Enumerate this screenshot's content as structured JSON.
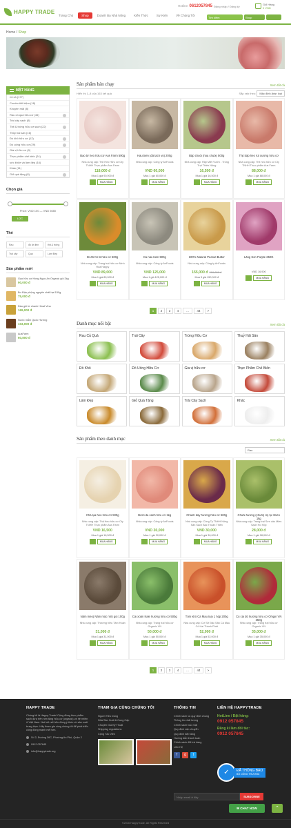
{
  "header": {
    "logo": "HAPPY TRADE",
    "nav": [
      "Trang Chủ",
      "Shop",
      "Doanh Ba Nhà Nông",
      "Kiến Thức",
      "Sự Kiện",
      "Về Chúng Tôi"
    ],
    "hotline_label": "Hotline:",
    "hotline": "0612057845",
    "toplinks": "Đăng nhập / Đăng ký",
    "cart_label": "Giỏ Hàng",
    "cart_price": "0 VND",
    "search_placeholder": "Tìm kiếm",
    "search_select": "Shop"
  },
  "breadcrumb": {
    "home": "Home",
    "current": "Shop"
  },
  "sidebar": {
    "category_title": "MẶT HÀNG",
    "categories": [
      "rồi xả (177)",
      "Combo tiết kiệm (18)",
      "Khuyến mãi (8)",
      "Rau củ quả hữu cơ (45)",
      "Trái cây sạch (9)",
      "Thịt & trứng hữu cơ sạch (22)",
      "Thủy hải sản (16)",
      "Đồ khô hữu cơ (12)",
      "Đồ uống hữu cơ (29)",
      "Gia vị hữu cơ (9)",
      "Thực phẩm chế biến (24)",
      "sức khỏe và làm đẹp (16)",
      "Khác (11)",
      "Giỏ quà tặng (8)"
    ],
    "price_title": "Chọn giá",
    "price_range": "Price: VND 100 — VND 5080",
    "filter_button": "LỌC",
    "tags_title": "Thẻ",
    "tags": [
      "Rau",
      "đồ ăn liền",
      "thịt & trứng",
      "Trái cây",
      "Quà",
      "Làm Đẹp"
    ],
    "new_title": "Sản phẩm mới",
    "new_products": [
      {
        "name": "Gạo hữu cơ Hồng Ngọc An Organic gói 2kg",
        "price": "90,000 đ",
        "color": "#d9c7a0"
      },
      {
        "name": "Bơ Đậu phộng nguyên chất hạt 150g",
        "price": "75,000 đ",
        "color": "#e0b764"
      },
      {
        "name": "Dầu gội từ chanh Hinat Vina",
        "price": "169,000 đ",
        "color": "#c9a23a"
      },
      {
        "name": "Nước mắm Quốc Hương",
        "price": "103,000 đ",
        "color": "#6b3e1e"
      },
      {
        "name": "AusFarm",
        "price": "60,800 đ",
        "color": "#c9c9c9"
      }
    ]
  },
  "main": {
    "bestseller_title": "Sản phẩm bán chạy",
    "view_all": "Xem tất cả",
    "result_count": "Hiển thị 1–8 của 163 kết quả",
    "sort_label": "Sắp xếp theo:",
    "sort_value": "Mặc định (bán loại",
    "buy_label": "MUA HÀNG",
    "bestsellers": [
      {
        "name": "Bao tử heo hữu cơ Aus Farm 500g",
        "supplier": "Nhà cung cấp: Thịt Heo Hữu cơ Cty TNHH Thực phẩm Aus Farm",
        "price": "118,000 đ",
        "min": "Mua 1 giá 90,000 đ",
        "c1": "#e8c9c4",
        "c2": "#f4e4df"
      },
      {
        "name": "Hàu biển (đã tách vỏ) 200g",
        "supplier": "Nhà cung cấp: Công ty AnFoods",
        "price": "VND 60,000",
        "min": "Mua 1 giá 60,000 đ",
        "c1": "#7a6a5a",
        "c2": "#c7b8a3"
      },
      {
        "name": "Bắp chuối (hoa chuối) 500g",
        "supplier": "Nhà cung cấp: Rẫy Miệt Vườn - Trồng Trọt Thiên Nông",
        "price": "16,500 đ",
        "min": "Mua 1 giá 16,500 đ",
        "c1": "#8a3a4f",
        "c2": "#b6c78c"
      },
      {
        "name": "Thịt bắp heo rút xương hữu cơ",
        "supplier": "Nhà cung cấp: Thịt heo hữu cơ Cty TNHH Thực phẩm Aus Farm",
        "price": "88,000 đ",
        "min": "Mua 1 giá 88,000 đ",
        "c1": "#c97a6b",
        "c2": "#e8b9a8"
      },
      {
        "name": "Bí đỏ hồ lô hữu cơ 500g",
        "supplier": "Nhà cung cấp: Trang trại hữu cơ Ninh Hoà Happy",
        "price": "VND 89,000",
        "min": "Mua 1 giá 89,000 đ",
        "c1": "#d98c2b",
        "c2": "#6d8a3a"
      },
      {
        "name": "Cá nâu biển 500g",
        "supplier": "Nhà cung cấp: Công ty AnFoods",
        "price": "VND 125,000",
        "min": "Mua 1 giá 125,000 đ",
        "c1": "#8d8a7f",
        "c2": "#c8c4b6"
      },
      {
        "name": "100% Natural Peanut Butter",
        "supplier": "Nhà cung cấp: Công ty AnFoods",
        "price": "155,000 đ",
        "old": "210,000 đ",
        "min": "Mua 3 giá 150,000 đ",
        "c1": "#c99a4a",
        "c2": "#e8d39c"
      },
      {
        "name": "Lăng Son Purple 250G",
        "supplier": "",
        "price": "",
        "min": "VND 16,900",
        "c1": "#a03a6a",
        "c2": "#e0a3c3"
      }
    ],
    "pages": [
      "1",
      "2",
      "3",
      "4",
      "...",
      "44",
      ">"
    ],
    "catalog_title": "Danh mục nổi bật",
    "catalog": [
      {
        "label": "Rau Củ Quả",
        "color": "#8bbf4f"
      },
      {
        "label": "Trái Cây",
        "color": "#d24a3a"
      },
      {
        "label": "Trứng Hữu Cơ",
        "color": "#d9a86a"
      },
      {
        "label": "Thuỷ Hải Sản",
        "color": "#9a8060"
      },
      {
        "label": "Đồ Khô",
        "color": "#c4a776"
      },
      {
        "label": "Đồ Uống Hữu Cơ",
        "color": "#5a8a4a"
      },
      {
        "label": "Gia vị hữu cơ",
        "color": "#b9a58c"
      },
      {
        "label": "Thực Phẩm Chế Biến",
        "color": "#c44a3a"
      },
      {
        "label": "Làm Đẹp",
        "color": "#c98a2a"
      },
      {
        "label": "Giỏ Quà Tặng",
        "color": "#8a6a3a"
      },
      {
        "label": "Trái Cây Sạch",
        "color": "#d2703a"
      },
      {
        "label": "Khác",
        "color": "#eeeeee"
      }
    ],
    "bycat_title": "Sản phẩm theo danh mục",
    "bycat_filter": "Rau",
    "bycat_products": [
      {
        "name": "Chả lụa heo hữu cơ 500g",
        "supplier": "Nhà cung cấp: Thịt Heo hữu cơ Cty TNHH Thực phẩm Aus Farm",
        "price": "VND 16,500",
        "min": "Mua 1 giá 16,500 đ",
        "c1": "#e6d3b0",
        "c2": "#f5efe3"
      },
      {
        "name": "Bưởi da xanh hữu cơ 1kg",
        "supplier": "Nhà cung cấp: Công ty AnFoods",
        "price": "VND 30,000",
        "min": "Mua 1 giá 30,000 đ",
        "c1": "#e08a7a",
        "c2": "#f2b8a8"
      },
      {
        "name": "Chanh dây hương hữu cơ 500g",
        "supplier": "Nhà cung cấp: Công Ty TNHH Nông Sản Sạch Bạc Thuận Thiên",
        "price": "VND 30,000",
        "min": "Mua 1 giá 30,000 đ",
        "c1": "#6a2a4a",
        "c2": "#d9a84a"
      },
      {
        "name": "Chuối hương (chuối) ơi) tự nhiên 1kg",
        "supplier": "Nhà cung cấp: Trang trại Sơn câu Miền Sạch Hồ Hộp",
        "price": "28,000 đ",
        "min": "Mua 1 giá 28,000 đ",
        "c1": "#6a8a3a",
        "c2": "#aac06a"
      },
      {
        "name": "Nấm mèo( Nấm mộc nhĩ) gói 100g",
        "supplier": "Nhà cung cấp: Thương hiệu Tâm Hoàn",
        "price": "31,000 đ",
        "min": "Mua 1 giá 31,000 đ",
        "c1": "#5a4a3a",
        "c2": "#8a7a6a"
      },
      {
        "name": "Cải xoăn Kale hương hữu cơ 500g",
        "supplier": "Nhà cung cấp: Trang trại hữu cơ Organic VN",
        "price": "50,000 đ",
        "min": "Mua 1 giá 50,000 đ",
        "c1": "#4a7a3a",
        "c2": "#8abf6a"
      },
      {
        "name": "Tôm khô Cà Mau loại 1 hộp 200g",
        "supplier": "Nhà cung cấp: Cơ Sở Đặc Sản Cà Mau Cô Hai Thành Phát",
        "price": "52,000 đ",
        "min": "Mua 1 giá 52,000 đ",
        "c1": "#c9502a",
        "c2": "#e8935a"
      },
      {
        "name": "Củ cải đỏ hương hữu cơ Ohigin VN 250g",
        "supplier": "Nhà cung cấp: Trang trại hữu cơ Organic VN",
        "price": "35,000 đ",
        "min": "Mua 1 giá 35,000 đ",
        "c1": "#b02a3a",
        "c2": "#7aa84a"
      }
    ]
  },
  "footer": {
    "about_title": "HAPPY TRADE",
    "about_text": "Chúng tôi là Happy Trade! Cộng đồng thực phẩm sạch đưa trên nền tảng hữu cơ (organic) và hệ nhiên ở Việt Nam. Nơi kết nối hữu đồng ý thức về sản xuất trung thực. Hãy tham gia cùng chúng tôi để phát triển cộng đồng mạnh mẽ hơn.",
    "address": "Số 2, Đường 36C, Phường An Phú, Quận 2",
    "phone": "0912 057845",
    "email": "info@happytrade.org",
    "join_title": "THAM GIA CÙNG CHÚNG TÔI",
    "join_links": [
      "Người Tiêu Dùng",
      "Nhà Sản Xuất & Cung Cấp",
      "Chuyên Gia Kỹ Thuật",
      "Shipping regulations",
      "Cộng Tác Viên"
    ],
    "info_title": "THÔNG TIN",
    "info_links": [
      "Chính sách và quy định chung",
      "Thông tin chất lượng",
      "Chính sách bảo mật",
      "Quy định vận chuyển",
      "Quy định đặt hàng",
      "Hướng dẫn thanh toán",
      "Chính sách đổi trả hàng",
      "Liên Hệ"
    ],
    "contact_title": "LIÊN HỆ HAPPYTRADE",
    "hotline_label": "HotLine / Đặt hàng:",
    "hotline": "0912 057845",
    "partner_label": "Đăng kí làm đối tác:",
    "partner": "0912 057845",
    "badge_text": "ĐÃ THÔNG BÁO",
    "badge_sub": "BỘ CÔNG THƯƠNG",
    "email_placeholder": "Nhập email ở đây",
    "subscribe": "SUBSCRIBE",
    "copyright": "©2016 HappyTrade. All Rights Reserved",
    "chat": "CHAT NOW"
  }
}
